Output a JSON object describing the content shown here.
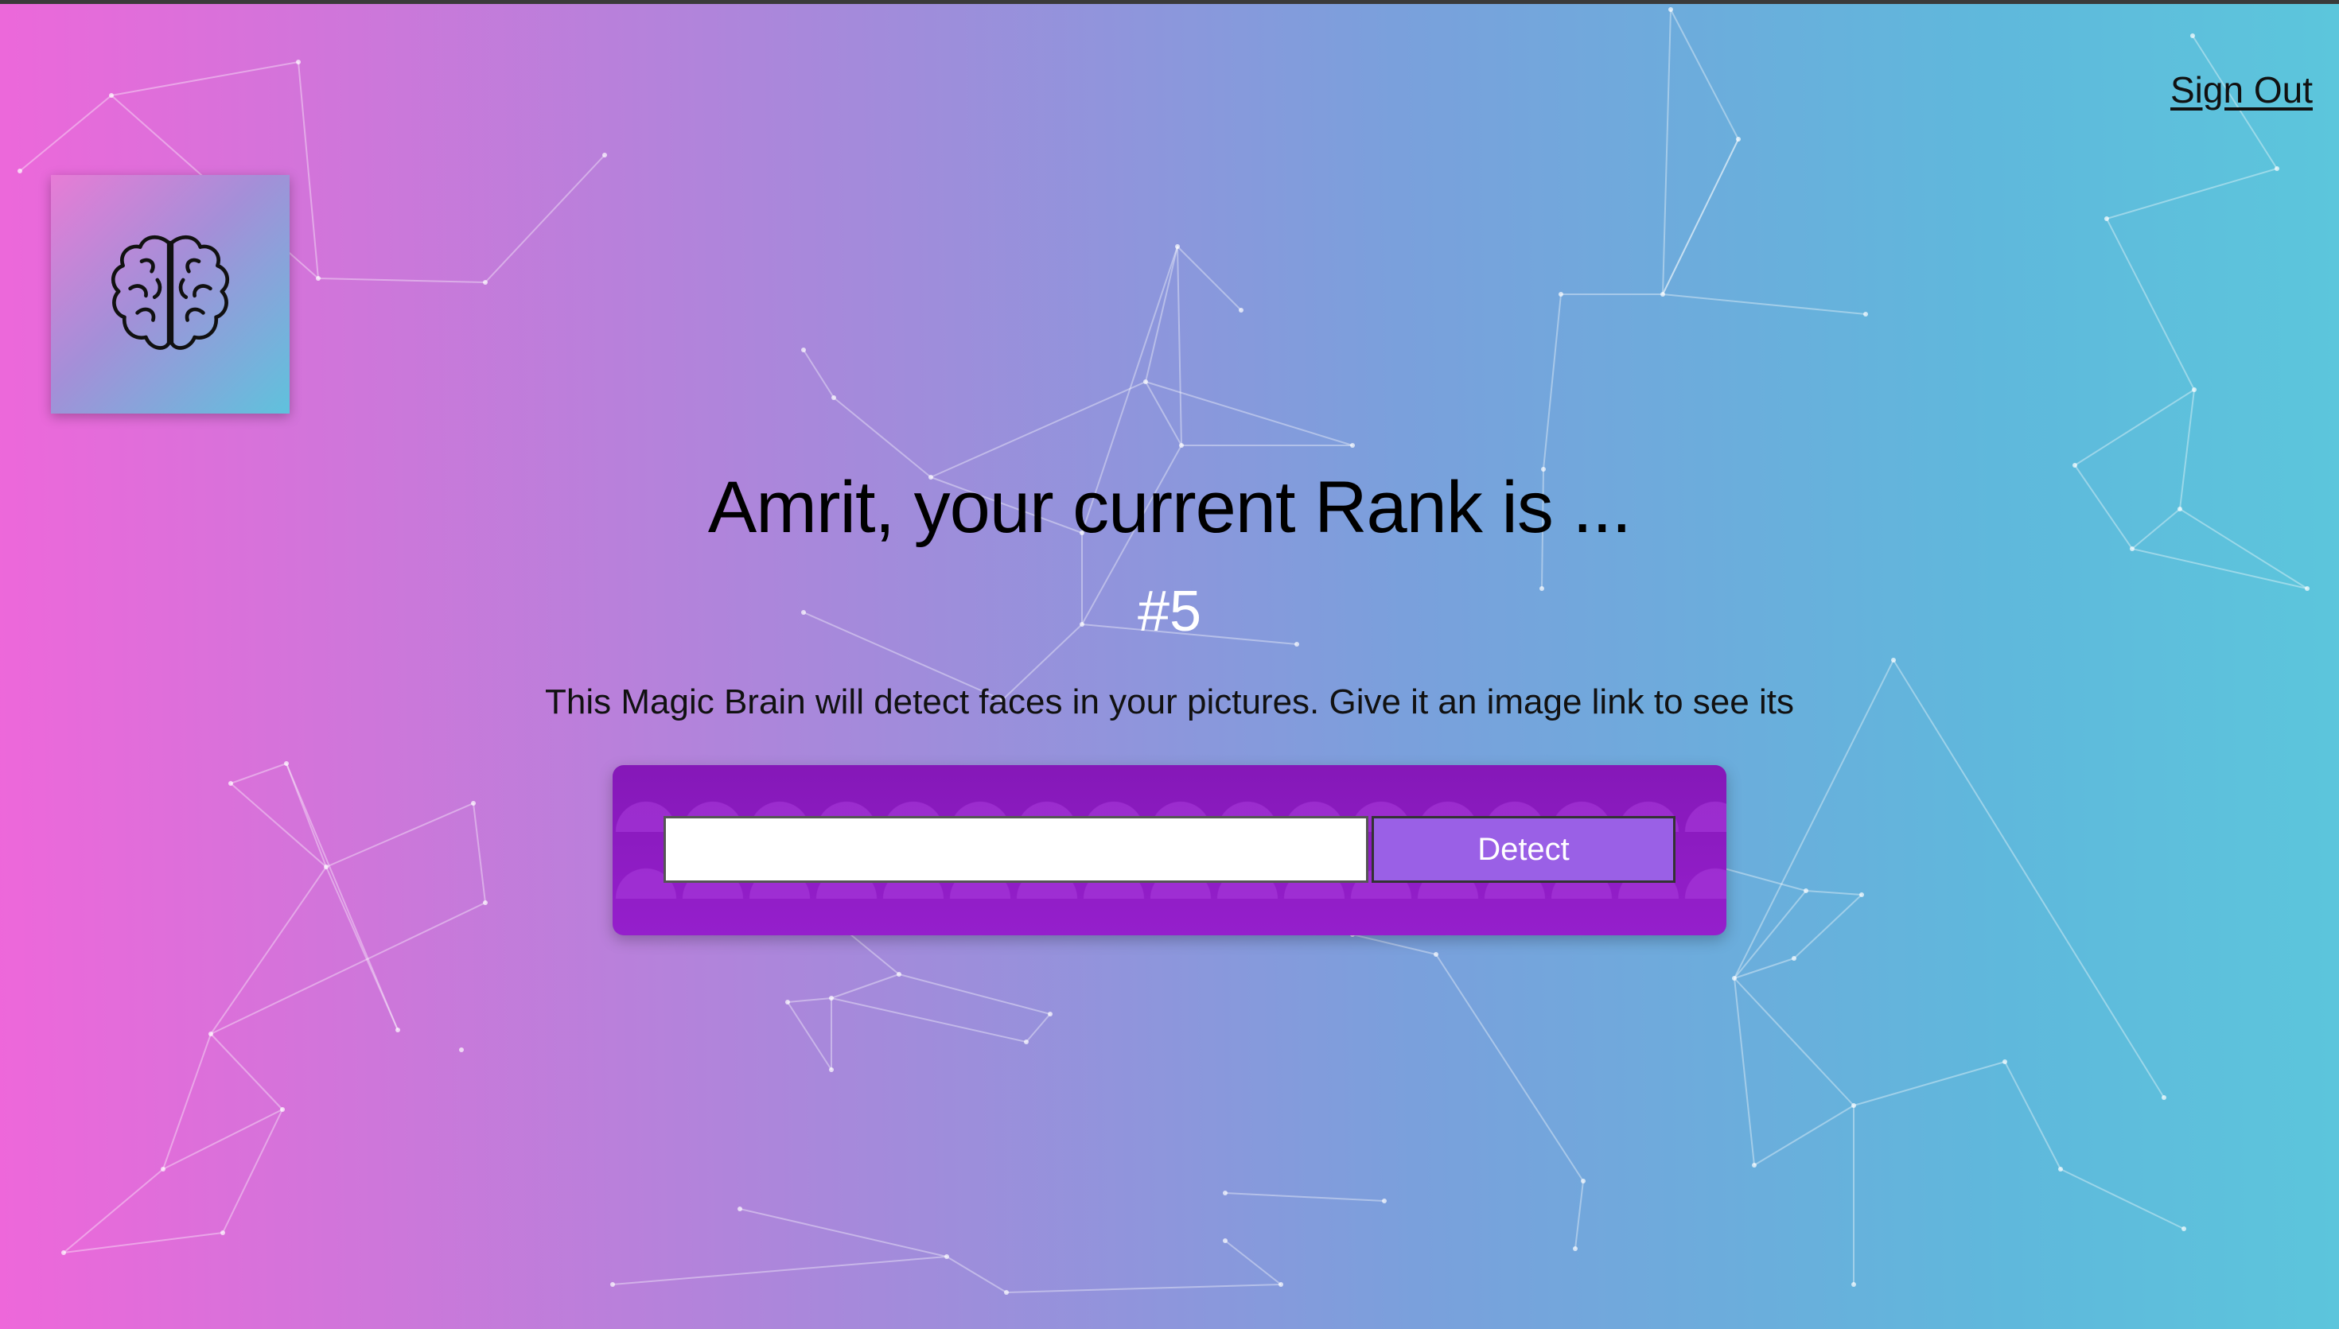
{
  "header": {
    "sign_out_label": "Sign Out"
  },
  "logo": {
    "icon": "brain-icon"
  },
  "rank": {
    "title": "Amrit, your current Rank is ...",
    "value": "#5"
  },
  "intro_text": "This Magic Brain will detect faces in your pictures. Give it an image link to see its",
  "form": {
    "input_value": "",
    "input_placeholder": "",
    "detect_label": "Detect"
  },
  "colors": {
    "gradient_start": "#ee67da",
    "gradient_end": "#5cc6dc",
    "panel": "#8d1fc4",
    "button": "#9a60e6"
  }
}
